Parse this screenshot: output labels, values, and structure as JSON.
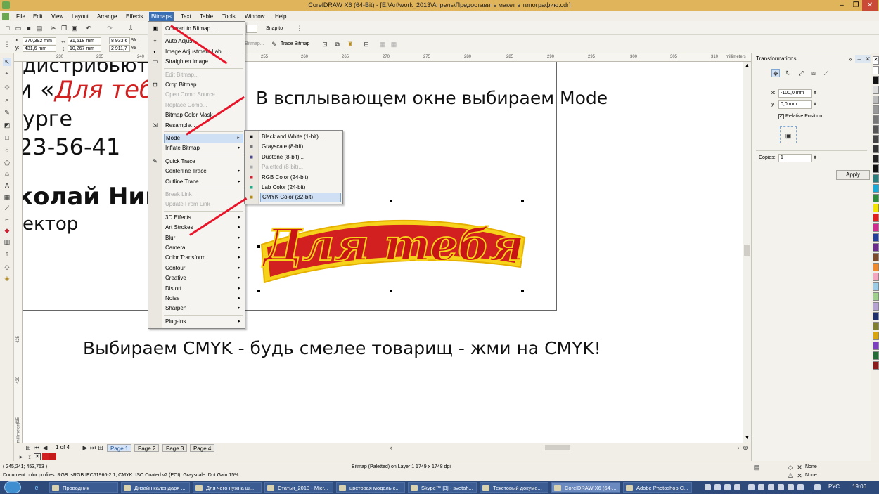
{
  "window": {
    "title": "CorelDRAW X6 (64-Bit) - [E:\\Art\\work_2013\\Апрель\\Предоставить макет в типографию.cdr]",
    "controls": [
      "–",
      "❐",
      "✕"
    ]
  },
  "menubar": {
    "items": [
      "File",
      "Edit",
      "View",
      "Layout",
      "Arrange",
      "Effects",
      "Bitmaps",
      "Text",
      "Table",
      "Tools",
      "Window",
      "Help"
    ],
    "active": "Bitmaps"
  },
  "toolbar": {
    "snap_to": "Snap to",
    "x_label": "x:",
    "x_value": "270,392 mm",
    "y_label": "y:",
    "y_value": "431,6 mm",
    "w_value": "31,518 mm",
    "h_value": "10,267 mm",
    "scale_w": "8 933,6",
    "scale_h": "2 911,7",
    "percent": "%",
    "bitmap_btn": "Bitmap...",
    "trace_bitmap": "Trace Bitmap"
  },
  "ruler": {
    "ticks": [
      "230",
      "235",
      "240",
      "245",
      "250",
      "255",
      "260",
      "265",
      "270",
      "275",
      "280",
      "285",
      "290",
      "295",
      "300",
      "305",
      "310"
    ],
    "unit": "millimeters",
    "vticks": [
      "425",
      "420",
      "415",
      "410"
    ],
    "vunit": "millimeters"
  },
  "document": {
    "lines": [
      "дистрибьют",
      "и «",
      "Для тебя",
      "урге",
      "23-56-41",
      "колай Нико",
      "ектор"
    ],
    "logo_text": "Для тебя"
  },
  "annotations": {
    "top": "В всплывающем окне выбираем Mode",
    "bottom": "Выбираем CMYK - будь смелее товарищ - жми на CMYK!"
  },
  "bitmaps_menu": {
    "items": [
      {
        "label": "Convert to Bitmap...",
        "disabled": false,
        "submenu": false
      },
      {
        "label": "Auto Adjust",
        "disabled": false,
        "submenu": false
      },
      {
        "label": "Image Adjustment Lab...",
        "disabled": false,
        "submenu": false
      },
      {
        "label": "Straighten Image...",
        "disabled": false,
        "submenu": false
      },
      {
        "label": "Edit Bitmap...",
        "disabled": true,
        "submenu": false
      },
      {
        "label": "Crop Bitmap",
        "disabled": false,
        "submenu": false
      },
      {
        "label": "Open Comp Source",
        "disabled": true,
        "submenu": false
      },
      {
        "label": "Replace Comp...",
        "disabled": true,
        "submenu": false
      },
      {
        "label": "Bitmap Color Mask",
        "disabled": false,
        "submenu": false
      },
      {
        "label": "Resample...",
        "disabled": false,
        "submenu": false
      },
      {
        "label": "Mode",
        "disabled": false,
        "submenu": true
      },
      {
        "label": "Inflate Bitmap",
        "disabled": false,
        "submenu": true
      },
      {
        "label": "Quick Trace",
        "disabled": false,
        "submenu": false
      },
      {
        "label": "Centerline Trace",
        "disabled": false,
        "submenu": true
      },
      {
        "label": "Outline Trace",
        "disabled": false,
        "submenu": true
      },
      {
        "label": "Break Link",
        "disabled": true,
        "submenu": false
      },
      {
        "label": "Update From Link",
        "disabled": true,
        "submenu": false
      },
      {
        "label": "3D Effects",
        "disabled": false,
        "submenu": true
      },
      {
        "label": "Art Strokes",
        "disabled": false,
        "submenu": true
      },
      {
        "label": "Blur",
        "disabled": false,
        "submenu": true
      },
      {
        "label": "Camera",
        "disabled": false,
        "submenu": true
      },
      {
        "label": "Color Transform",
        "disabled": false,
        "submenu": true
      },
      {
        "label": "Contour",
        "disabled": false,
        "submenu": true
      },
      {
        "label": "Creative",
        "disabled": false,
        "submenu": true
      },
      {
        "label": "Distort",
        "disabled": false,
        "submenu": true
      },
      {
        "label": "Noise",
        "disabled": false,
        "submenu": true
      },
      {
        "label": "Sharpen",
        "disabled": false,
        "submenu": true
      },
      {
        "label": "Plug-Ins",
        "disabled": false,
        "submenu": true
      }
    ]
  },
  "mode_submenu": {
    "items": [
      {
        "label": "Black and White (1-bit)...",
        "disabled": false
      },
      {
        "label": "Grayscale (8-bit)",
        "disabled": false
      },
      {
        "label": "Duotone (8-bit)...",
        "disabled": false
      },
      {
        "label": "Paletted (8-bit)...",
        "disabled": true
      },
      {
        "label": "RGB Color (24-bit)",
        "disabled": false
      },
      {
        "label": "Lab Color (24-bit)",
        "disabled": false
      },
      {
        "label": "CMYK Color (32-bit)",
        "disabled": false
      }
    ],
    "highlighted": "CMYK Color (32-bit)"
  },
  "docker": {
    "title": "Transformations",
    "x_label": "x:",
    "x_value": "-100,0 mm",
    "y_label": "y:",
    "y_value": "0,0 mm",
    "relative_position": "Relative Position",
    "copies_label": "Copies:",
    "copies_value": "1",
    "apply": "Apply"
  },
  "pages": {
    "counter": "1 of 4",
    "tabs": [
      "Page 1",
      "Page 2",
      "Page 3",
      "Page 4"
    ],
    "active": "Page 1"
  },
  "status": {
    "coords": "( 245,241; 453,763 )",
    "object_info": "Bitmap (Paletted) on Layer 1 1749 x 1748 dpi",
    "profiles": "Document color profiles: RGB: sRGB IEC61966-2.1; CMYK: ISO Coated v2 (ECI); Grayscale: Dot Gain 15%",
    "fill": "None",
    "outline": "None"
  },
  "taskbar": {
    "tasks": [
      "Проводник",
      "Дизайн календаря ...",
      "Для чего нужна ш...",
      "Статьи_2013 - Micr...",
      "цветовая модель с...",
      "Skype™ [3] - svetah...",
      "Текстовый докуме...",
      "CorelDRAW X6 (64-...",
      "Adobe Photoshop C..."
    ],
    "active": "CorelDRAW X6 (64-...",
    "lang": "РУС",
    "time": "19:06"
  },
  "colors": {
    "accent": "#3b6fb3",
    "logo_red": "#d21f1f",
    "logo_yellow": "#f6d21a",
    "arrow_red": "#e8152a"
  }
}
